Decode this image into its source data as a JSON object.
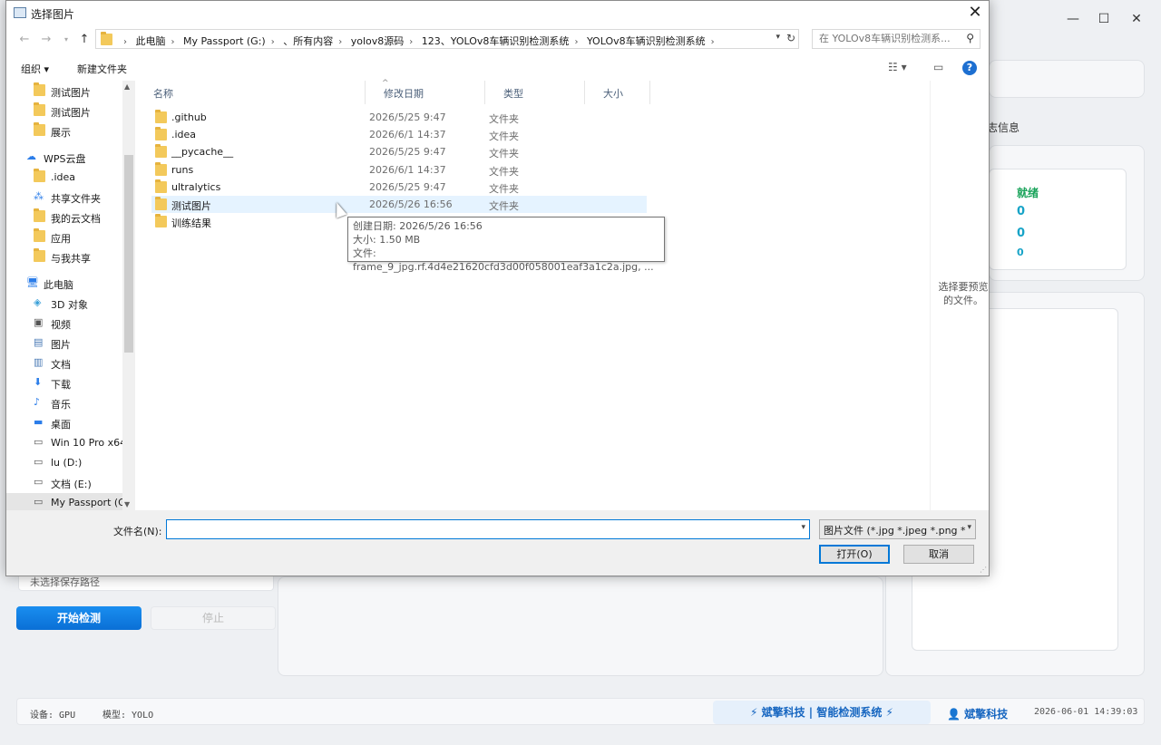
{
  "background_app": {
    "window_controls": [
      "—",
      "☐",
      "✕"
    ],
    "tab_fragment": "志信息",
    "status_label": "就绪",
    "stats": [
      "0",
      "0",
      "0"
    ],
    "preview_hint": "选择要预览的文件。",
    "save_path_text": "未选择保存路径",
    "start_button": "开始检测",
    "stop_button": "停止",
    "statusbar": {
      "device": "设备: GPU",
      "model": "模型: YOLO",
      "brand": "⚡ 斌擎科技 | 智能检测系统 ⚡",
      "user": "斌擎科技",
      "time": "2026-06-01 14:39:03"
    }
  },
  "dialog": {
    "title": "选择图片",
    "breadcrumbs": [
      "此电脑",
      "My Passport (G:)",
      "、所有内容",
      "yolov8源码",
      "123、YOLOv8车辆识别检测系统",
      "YOLOv8车辆识别检测系统"
    ],
    "search_placeholder": "在 YOLOv8车辆识别检测系...",
    "toolbar": {
      "organize": "组织 ▾",
      "new_folder": "新建文件夹"
    },
    "nav_items": [
      {
        "label": "测试图片",
        "icon": "folder-icon",
        "indent": 1
      },
      {
        "label": "测试图片",
        "icon": "folder-icon",
        "indent": 1
      },
      {
        "label": "展示",
        "icon": "folder-icon",
        "indent": 1
      },
      {
        "label": "WPS云盘",
        "icon": "cloud-icon",
        "indent": 0
      },
      {
        "label": ".idea",
        "icon": "folder-icon",
        "indent": 1
      },
      {
        "label": "共享文件夹",
        "icon": "share-icon",
        "indent": 1
      },
      {
        "label": "我的云文档",
        "icon": "folder-icon",
        "indent": 1
      },
      {
        "label": "应用",
        "icon": "folder-icon",
        "indent": 1
      },
      {
        "label": "与我共享",
        "icon": "folder-icon",
        "indent": 1
      },
      {
        "label": "此电脑",
        "icon": "computer-icon",
        "indent": 0
      },
      {
        "label": "3D 对象",
        "icon": "cube-icon",
        "indent": 1
      },
      {
        "label": "视频",
        "icon": "video-icon",
        "indent": 1
      },
      {
        "label": "图片",
        "icon": "picture-icon",
        "indent": 1
      },
      {
        "label": "文档",
        "icon": "document-icon",
        "indent": 1
      },
      {
        "label": "下载",
        "icon": "download-icon",
        "indent": 1
      },
      {
        "label": "音乐",
        "icon": "music-icon",
        "indent": 1
      },
      {
        "label": "桌面",
        "icon": "desktop-icon",
        "indent": 1
      },
      {
        "label": "Win 10 Pro x64",
        "icon": "drive-icon",
        "indent": 1
      },
      {
        "label": "lu (D:)",
        "icon": "drive-icon",
        "indent": 1
      },
      {
        "label": "文档 (E:)",
        "icon": "drive-icon",
        "indent": 1
      },
      {
        "label": "My Passport (G",
        "icon": "drive-icon",
        "indent": 1
      }
    ],
    "columns": [
      "名称",
      "修改日期",
      "类型",
      "大小"
    ],
    "files": [
      {
        "name": ".github",
        "date": "2026/5/25 9:47",
        "type": "文件夹"
      },
      {
        "name": ".idea",
        "date": "2026/6/1 14:37",
        "type": "文件夹"
      },
      {
        "name": "__pycache__",
        "date": "2026/5/25 9:47",
        "type": "文件夹"
      },
      {
        "name": "runs",
        "date": "2026/6/1 14:37",
        "type": "文件夹"
      },
      {
        "name": "ultralytics",
        "date": "2026/5/25 9:47",
        "type": "文件夹"
      },
      {
        "name": "测试图片",
        "date": "2026/5/26 16:56",
        "type": "文件夹"
      },
      {
        "name": "训练结果",
        "date": "",
        "type": ""
      }
    ],
    "tooltip": {
      "created": "创建日期: 2026/5/26 16:56",
      "size": "大小: 1.50 MB",
      "files": "文件: frame_9_jpg.rf.4d4e21620cfd3d00f058001eaf3a1c2a.jpg, ..."
    },
    "preview_text": "选择要预览的文件。",
    "filename_label": "文件名(N):",
    "filename_value": "",
    "filter": "图片文件 (*.jpg *.jpeg *.png *",
    "open_button": "打开(O)",
    "cancel_button": "取消"
  }
}
